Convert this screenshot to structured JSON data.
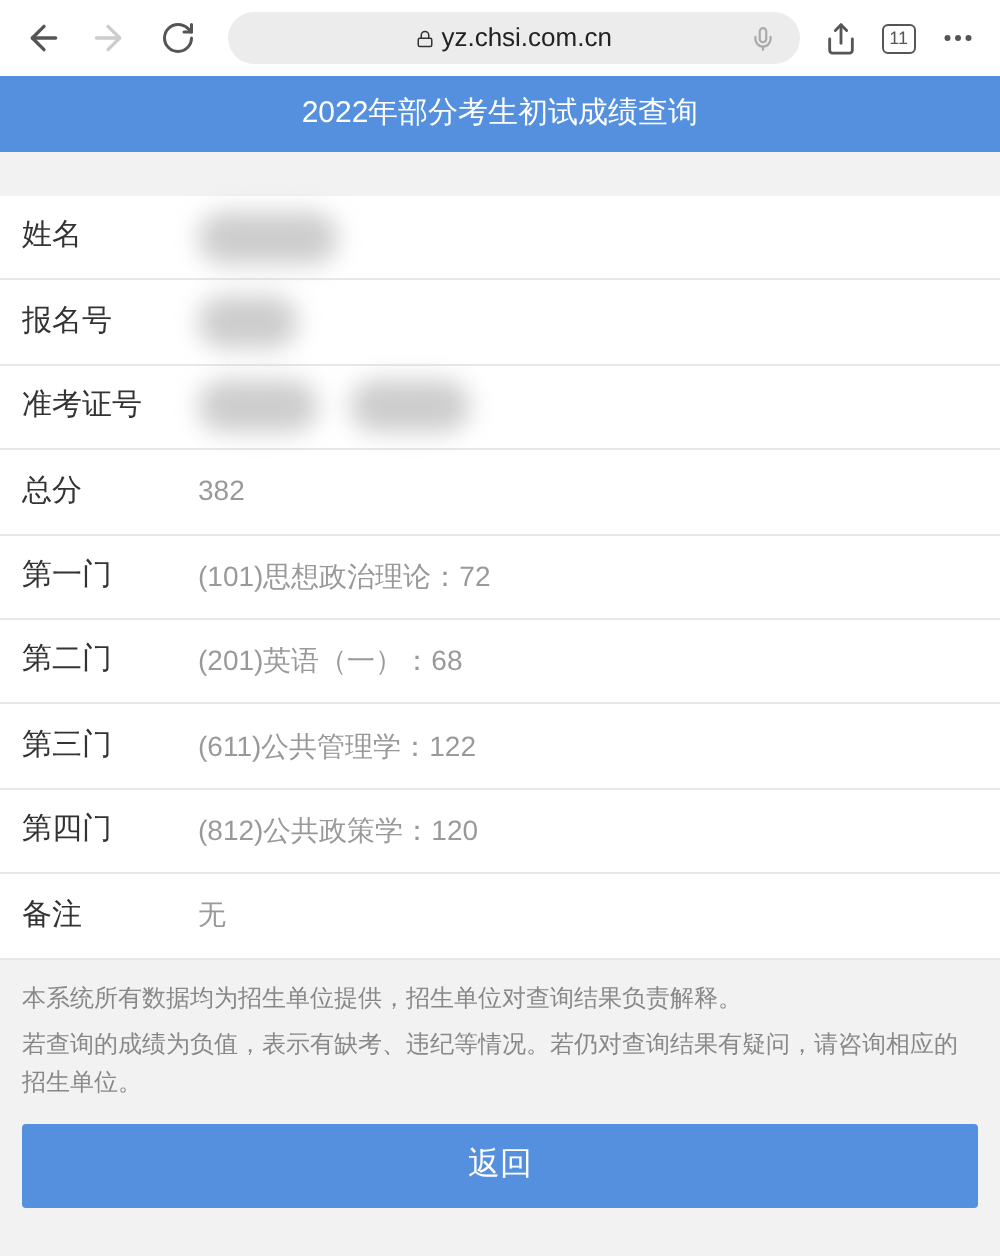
{
  "browser": {
    "url": "yz.chsi.com.cn",
    "tab_count": "11"
  },
  "header": {
    "title": "2022年部分考生初试成绩查询"
  },
  "rows": [
    {
      "label": "姓名",
      "kind": "redacted"
    },
    {
      "label": "报名号",
      "kind": "redacted"
    },
    {
      "label": "准考证号",
      "kind": "redacted"
    },
    {
      "label": "总分",
      "kind": "text",
      "value": "382"
    },
    {
      "label": "第一门",
      "kind": "text",
      "value": "(101)思想政治理论：72"
    },
    {
      "label": "第二门",
      "kind": "text",
      "value": "(201)英语（一）：68"
    },
    {
      "label": "第三门",
      "kind": "text",
      "value": "(611)公共管理学：122"
    },
    {
      "label": "第四门",
      "kind": "text",
      "value": "(812)公共政策学：120"
    },
    {
      "label": "备注",
      "kind": "text",
      "value": "无"
    }
  ],
  "notes": [
    "本系统所有数据均为招生单位提供，招生单位对查询结果负责解释。",
    "若查询的成绩为负值，表示有缺考、违纪等情况。若仍对查询结果有疑问，请咨询相应的招生单位。"
  ],
  "back_button": "返回"
}
